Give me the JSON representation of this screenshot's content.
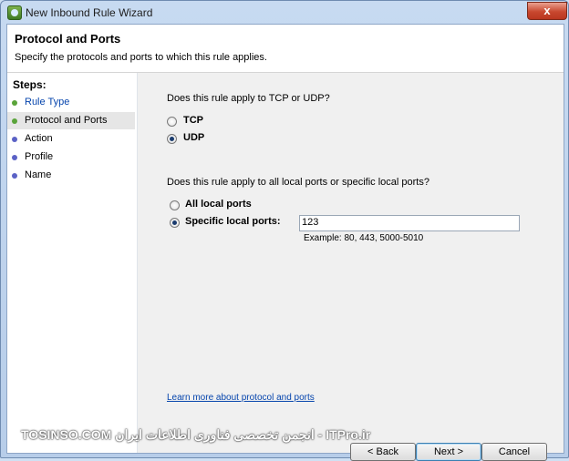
{
  "window": {
    "title": "New Inbound Rule Wizard",
    "close_glyph": "x"
  },
  "header": {
    "title": "Protocol and Ports",
    "subtitle": "Specify the protocols and ports to which this rule applies."
  },
  "steps": {
    "title": "Steps:",
    "items": [
      {
        "label": "Rule Type",
        "state": "done"
      },
      {
        "label": "Protocol and Ports",
        "state": "current"
      },
      {
        "label": "Action",
        "state": "todo"
      },
      {
        "label": "Profile",
        "state": "todo"
      },
      {
        "label": "Name",
        "state": "todo"
      }
    ]
  },
  "protocol": {
    "question": "Does this rule apply to TCP or UDP?",
    "tcp_label": "TCP",
    "udp_label": "UDP",
    "selected": "UDP"
  },
  "ports": {
    "question": "Does this rule apply to all local ports or specific local ports?",
    "all_label": "All local ports",
    "specific_label": "Specific local ports:",
    "selected": "specific",
    "value": "123",
    "example": "Example: 80, 443, 5000-5010"
  },
  "learn_more": "Learn more about protocol and ports",
  "buttons": {
    "back": "< Back",
    "next": "Next >",
    "cancel": "Cancel"
  },
  "watermark": "TOSINSO.COM انجمن تخصصی فناوری اطلاعات ایران - ITPro.ir",
  "colors": {
    "done_dot": "#5aa43a",
    "todo_dot": "#5b62c6",
    "link": "#0645ad",
    "close": "#c8482f"
  }
}
